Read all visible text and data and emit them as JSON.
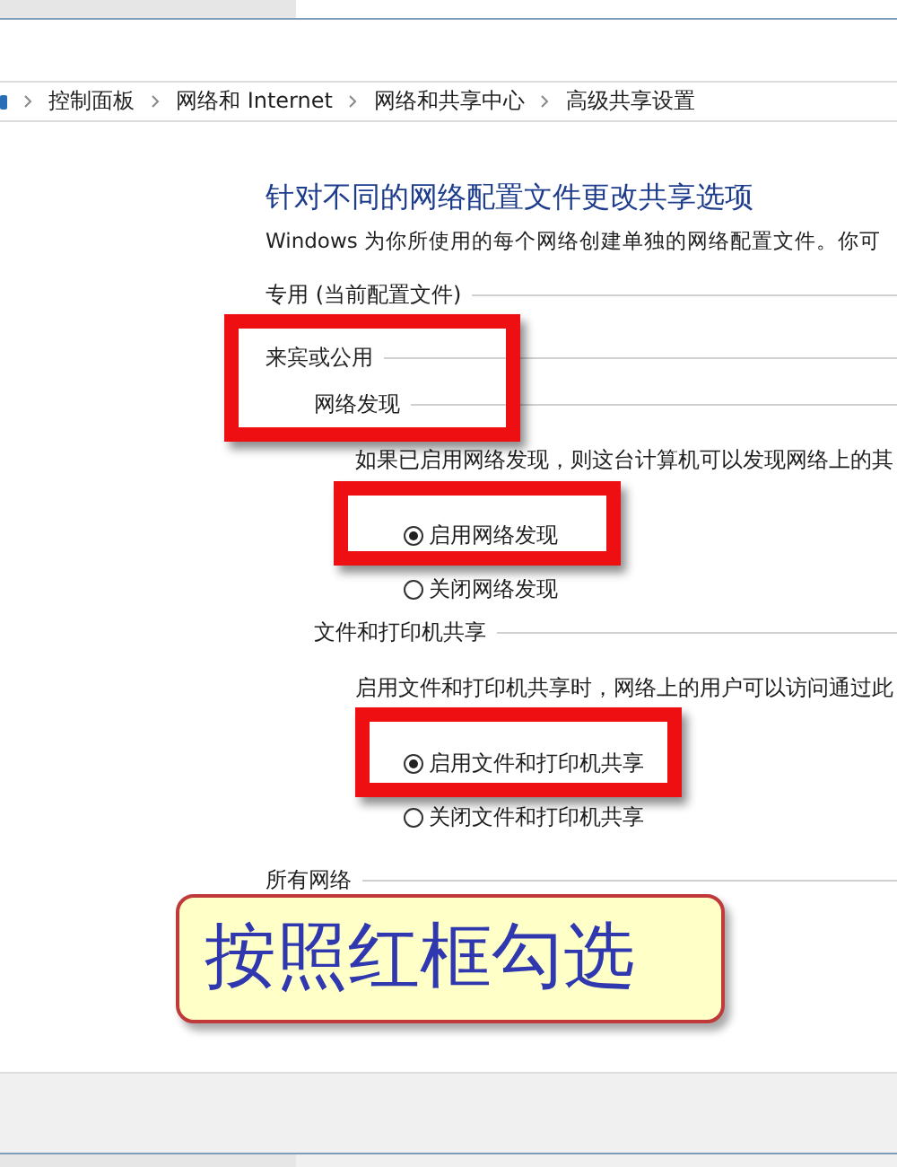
{
  "breadcrumb": [
    "控制面板",
    "网络和 Internet",
    "网络和共享中心",
    "高级共享设置"
  ],
  "heading": "针对不同的网络配置文件更改共享选项",
  "intro": "Windows 为你所使用的每个网络创建单独的网络配置文件。你可",
  "profiles": [
    {
      "name": "专用 (当前配置文件)"
    },
    {
      "name": "来宾或公用",
      "groups": [
        {
          "name": "网络发现",
          "description": "如果已启用网络发现，则这台计算机可以发现网络上的其",
          "options": [
            {
              "label": "启用网络发现",
              "selected": true
            },
            {
              "label": "关闭网络发现",
              "selected": false
            }
          ]
        },
        {
          "name": "文件和打印机共享",
          "description": "启用文件和打印机共享时，网络上的用户可以访问通过此",
          "options": [
            {
              "label": "启用文件和打印机共享",
              "selected": true
            },
            {
              "label": "关闭文件和打印机共享",
              "selected": false
            }
          ]
        }
      ]
    },
    {
      "name": "所有网络"
    }
  ],
  "callout": "按照红框勾选"
}
